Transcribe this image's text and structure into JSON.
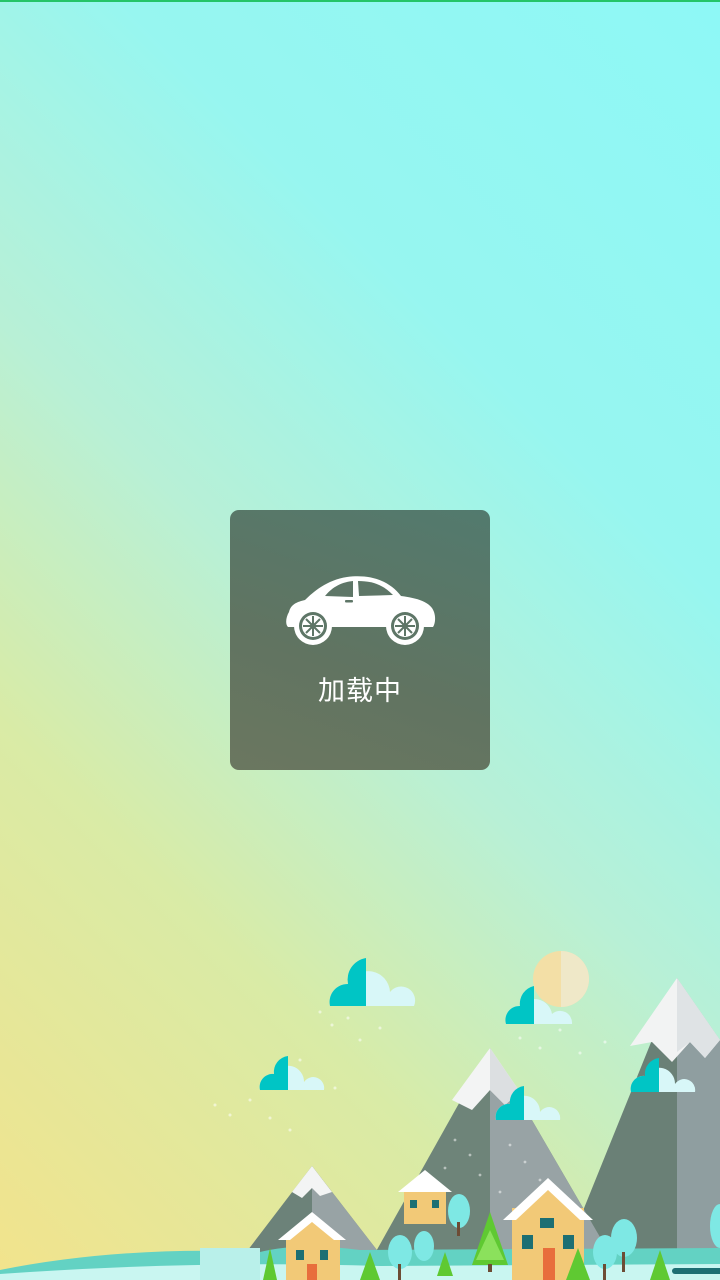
{
  "colors": {
    "background_top": "#8ef8f6",
    "background_bottom": "#f2e38c",
    "dialog": "#5e7667",
    "text": "#ffffff",
    "status_line": "#25c468",
    "cloud": "#00c8c8",
    "snow_peak": "#f5f5f5",
    "mountain": "#6f8578"
  },
  "loading": {
    "icon": "car-icon",
    "text": "加载中"
  },
  "illustration": {
    "icons": [
      "cloud-icon",
      "sun-icon",
      "mountain-icon",
      "house-icon",
      "tree-icon"
    ]
  }
}
